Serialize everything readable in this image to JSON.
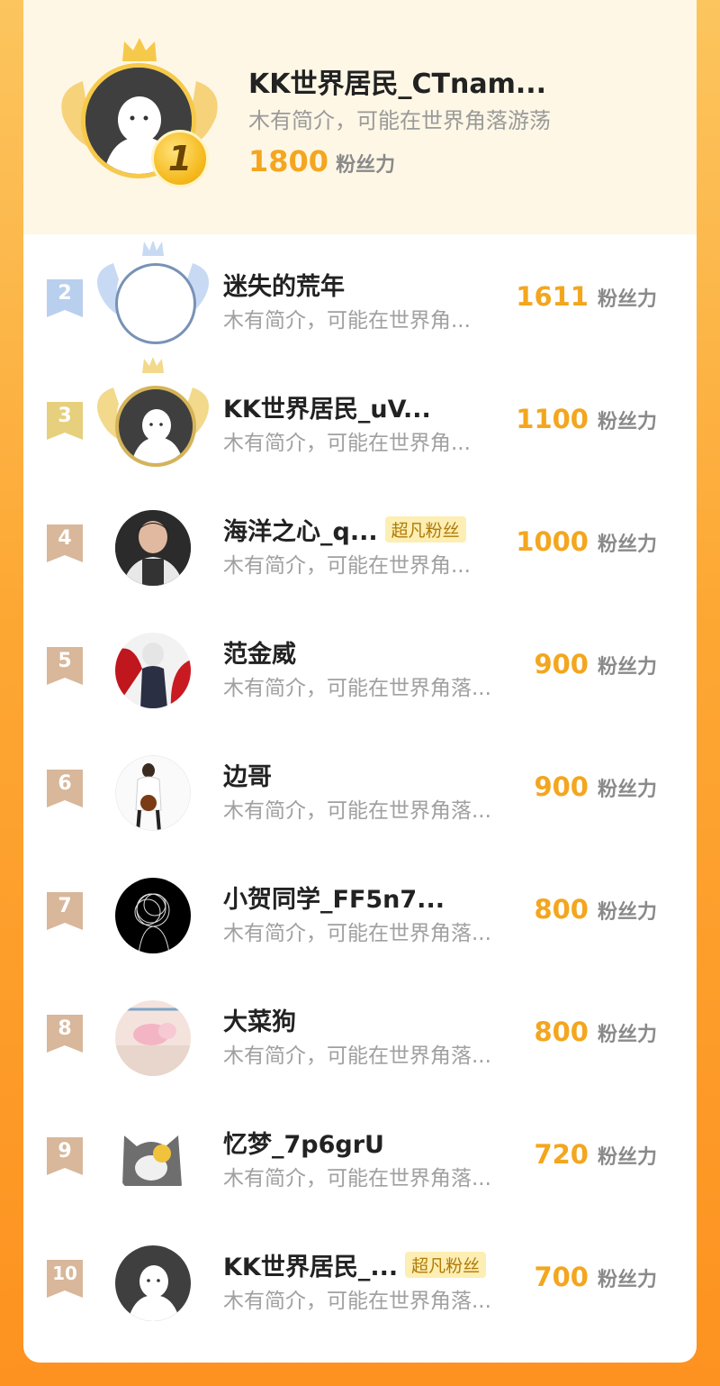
{
  "top": {
    "name": "KK世界居民_CTnam...",
    "intro": "木有简介，可能在世界角落游荡",
    "score": "1800",
    "unit": "粉丝力",
    "rank": "1"
  },
  "rows": [
    {
      "rank": "2",
      "name": "迷失的荒年",
      "tag": "",
      "intro": "木有简介，可能在世界角...",
      "score": "1611",
      "unit": "粉丝力"
    },
    {
      "rank": "3",
      "name": "KK世界居民_uV...",
      "tag": "",
      "intro": "木有简介，可能在世界角...",
      "score": "1100",
      "unit": "粉丝力"
    },
    {
      "rank": "4",
      "name": "海洋之心_q...",
      "tag": "超凡粉丝",
      "intro": "木有简介，可能在世界角...",
      "score": "1000",
      "unit": "粉丝力"
    },
    {
      "rank": "5",
      "name": "范金威",
      "tag": "",
      "intro": "木有简介，可能在世界角落...",
      "score": "900",
      "unit": "粉丝力"
    },
    {
      "rank": "6",
      "name": "边哥",
      "tag": "",
      "intro": "木有简介，可能在世界角落...",
      "score": "900",
      "unit": "粉丝力"
    },
    {
      "rank": "7",
      "name": "小贺同学_FF5n7...",
      "tag": "",
      "intro": "木有简介，可能在世界角落...",
      "score": "800",
      "unit": "粉丝力"
    },
    {
      "rank": "8",
      "name": "大菜狗",
      "tag": "",
      "intro": "木有简介，可能在世界角落...",
      "score": "800",
      "unit": "粉丝力"
    },
    {
      "rank": "9",
      "name": "忆梦_7p6grU",
      "tag": "",
      "intro": "木有简介，可能在世界角落...",
      "score": "720",
      "unit": "粉丝力"
    },
    {
      "rank": "10",
      "name": "KK世界居民_...",
      "tag": "超凡粉丝",
      "intro": "木有简介，可能在世界角落...",
      "score": "700",
      "unit": "粉丝力"
    }
  ],
  "colors": {
    "accent": "#f3a61e",
    "gold": "#f6c94a",
    "silver": "#a9c2e4",
    "bronze": "#e6cd7a",
    "rank_badge": "#d8b79a",
    "tag_bg": "#fdeeb3"
  }
}
